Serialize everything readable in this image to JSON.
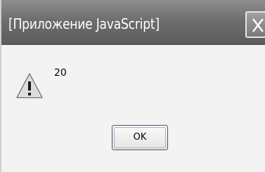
{
  "window": {
    "title": "[Приложение JavaScript]"
  },
  "dialog": {
    "message": "20",
    "icon": "warning-icon",
    "ok_label": "OK"
  },
  "colors": {
    "titlebar": "#6e6e6e",
    "background": "#f3f3f3"
  }
}
